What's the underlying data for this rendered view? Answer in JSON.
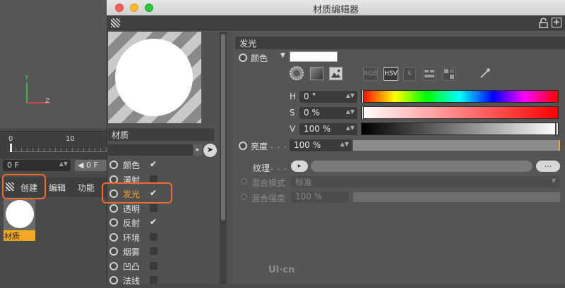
{
  "left_app": {
    "axis_y": "Y",
    "axis_x": "Z",
    "timeline": {
      "tick_start": "0",
      "tick_10": "10"
    },
    "frame_field": "0 F",
    "frame_field2": "◀ 0 F",
    "menu": {
      "create": "创建",
      "edit": "编辑",
      "func": "功能"
    },
    "material_label": "材质"
  },
  "window": {
    "title": "材质编辑器"
  },
  "left_panel": {
    "section_title": "材质",
    "channels": [
      {
        "label": "颜色",
        "checked": true
      },
      {
        "label": "漫射",
        "checked": false
      },
      {
        "label": "发光",
        "checked": true,
        "active": true
      },
      {
        "label": "透明",
        "checked": false
      },
      {
        "label": "反射",
        "checked": true
      },
      {
        "label": "环境",
        "checked": false
      },
      {
        "label": "烟雾",
        "checked": false
      },
      {
        "label": "凹凸",
        "checked": false
      },
      {
        "label": "法线",
        "checked": false
      }
    ]
  },
  "glow_panel": {
    "header": "发光",
    "color_label": "颜色",
    "color_value": "#ffffff",
    "mode_buttons": [
      "RGB",
      "HSV",
      "K"
    ],
    "active_mode": "HSV",
    "h": {
      "label": "H",
      "value": "0 °",
      "fraction": 0.0
    },
    "s": {
      "label": "S",
      "value": "0 %",
      "fraction": 0.0
    },
    "v": {
      "label": "V",
      "value": "100 %",
      "fraction": 1.0
    },
    "brightness": {
      "label": "亮度",
      "dots": ". . .",
      "value": "100 %",
      "fraction": 1.0
    },
    "texture": {
      "label": "纹理",
      "dots": ". . .",
      "button": "▸",
      "more": "..."
    },
    "blend_mode": {
      "label": "混合模式",
      "value": "标准"
    },
    "blend_strength": {
      "label": "混合强度",
      "value": "100 %"
    }
  },
  "watermark": "UI·cn"
}
